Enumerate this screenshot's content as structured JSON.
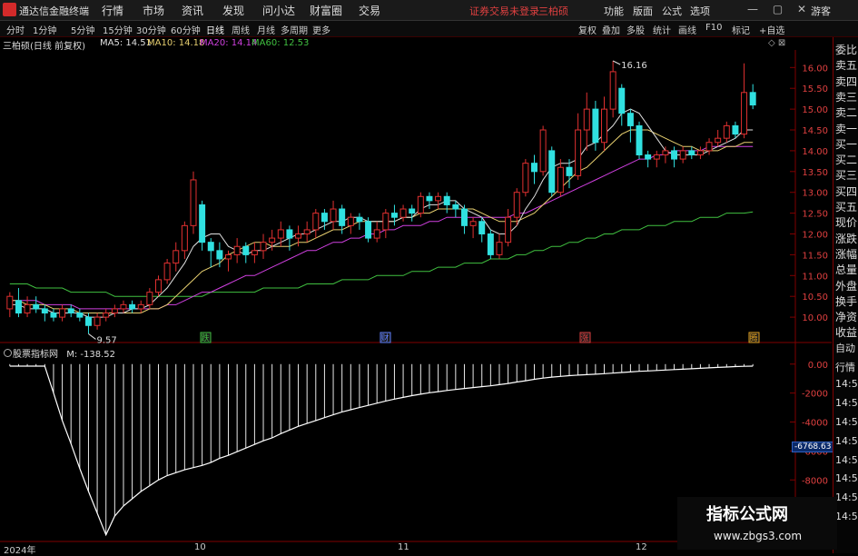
{
  "app": {
    "title": "通达信金融终端",
    "menu": [
      "行情",
      "市场",
      "资讯",
      "发现",
      "问小达",
      "财富圈",
      "交易"
    ],
    "login_status": "证券交易未登录",
    "stock_top": "三柏硕",
    "right_menu": [
      "功能",
      "版面",
      "公式",
      "选项"
    ],
    "share_label": "游客",
    "window_controls": "— ▢ ✕"
  },
  "periods": [
    "分时",
    "1分钟",
    "5分钟",
    "15分钟",
    "30分钟",
    "60分钟",
    "日线",
    "周线",
    "月线",
    "多周期",
    "更多"
  ],
  "active_period": "日线",
  "tools": [
    "复权",
    "叠加",
    "多股",
    "统计",
    "画线",
    "F10",
    "标记",
    "+自选"
  ],
  "stock": {
    "title": "三柏硕(日线 前复权)",
    "ma": [
      {
        "label": "MA5: 14.51",
        "color": "#e0e0e0"
      },
      {
        "label": "MA10: 14.18",
        "color": "#e8d070"
      },
      {
        "label": "MA20: 14.14",
        "color": "#d040e0"
      },
      {
        "label": "MA60: 12.53",
        "color": "#40c040"
      }
    ]
  },
  "price_axis": [
    "16.00",
    "15.50",
    "15.00",
    "14.50",
    "14.00",
    "13.50",
    "13.00",
    "12.50",
    "12.00",
    "11.50",
    "11.00",
    "10.50",
    "10.00"
  ],
  "annotations": {
    "high": "16.16",
    "low": "9.57",
    "events": [
      {
        "text": "跌",
        "color": "#40c040"
      },
      {
        "text": "财",
        "color": "#6080ff"
      },
      {
        "text": "涨",
        "color": "#e04040"
      },
      {
        "text": "腾",
        "color": "#e0a020"
      }
    ]
  },
  "sub_panel": {
    "title": "股票指标网",
    "value": "M: -138.52",
    "axis": [
      "0.00",
      "-2000",
      "-4000",
      "-6000",
      "-8000",
      "-10000"
    ],
    "current_value": "-6768.63"
  },
  "date_axis": [
    "2024年",
    "10",
    "11",
    "12"
  ],
  "right_panel": [
    "委比",
    "卖五",
    "卖四",
    "卖三",
    "卖二",
    "卖一",
    "买一",
    "买二",
    "买三",
    "买四",
    "买五",
    "现价",
    "涨跌",
    "涨幅",
    "总量",
    "外盘",
    "换手",
    "净资",
    "收益",
    "自动",
    "行情",
    "14:5",
    "14:5",
    "14:5",
    "14:5",
    "14:5",
    "14:5",
    "14:5",
    "14:5"
  ],
  "watermark": {
    "text": "指标公式网",
    "url": "www.zbgs3.com"
  },
  "colors": {
    "up": "#e03030",
    "down": "#30e0e0",
    "ma5": "#e0e0e0",
    "ma10": "#e8d070",
    "ma20": "#d040e0",
    "ma60": "#40c040"
  },
  "chart_data": {
    "type": "candlestick",
    "title": "三柏硕(日线 前复权)",
    "ylim": [
      9.5,
      16.4
    ],
    "candles": [
      [
        10.2,
        10.5,
        10.0,
        10.6
      ],
      [
        10.4,
        10.1,
        10.0,
        10.7
      ],
      [
        10.1,
        10.3,
        10.0,
        10.5
      ],
      [
        10.3,
        10.2,
        10.1,
        10.5
      ],
      [
        10.2,
        10.1,
        9.9,
        10.3
      ],
      [
        10.1,
        10.0,
        9.9,
        10.2
      ],
      [
        10.0,
        10.2,
        9.9,
        10.3
      ],
      [
        10.2,
        10.1,
        10.0,
        10.3
      ],
      [
        10.1,
        10.0,
        9.9,
        10.2
      ],
      [
        10.0,
        9.8,
        9.6,
        10.1
      ],
      [
        9.8,
        10.0,
        9.7,
        10.1
      ],
      [
        10.0,
        10.1,
        9.9,
        10.2
      ],
      [
        10.1,
        10.2,
        10.0,
        10.3
      ],
      [
        10.2,
        10.3,
        10.1,
        10.4
      ],
      [
        10.3,
        10.2,
        10.1,
        10.4
      ],
      [
        10.2,
        10.3,
        10.1,
        10.4
      ],
      [
        10.3,
        10.6,
        10.2,
        10.7
      ],
      [
        10.6,
        10.9,
        10.5,
        11.0
      ],
      [
        10.9,
        11.3,
        10.8,
        11.4
      ],
      [
        11.3,
        11.6,
        11.1,
        11.8
      ],
      [
        11.6,
        12.2,
        11.4,
        12.3
      ],
      [
        12.2,
        13.3,
        12.0,
        13.5
      ],
      [
        12.7,
        11.8,
        11.6,
        12.8
      ],
      [
        11.8,
        11.6,
        11.2,
        11.9
      ],
      [
        11.6,
        11.4,
        11.2,
        11.8
      ],
      [
        11.4,
        11.5,
        11.1,
        11.6
      ],
      [
        11.5,
        11.7,
        11.3,
        11.9
      ],
      [
        11.7,
        11.5,
        11.3,
        11.8
      ],
      [
        11.5,
        11.6,
        11.3,
        11.8
      ],
      [
        11.6,
        11.8,
        11.4,
        12.0
      ],
      [
        11.8,
        11.9,
        11.6,
        12.1
      ],
      [
        11.9,
        12.1,
        11.7,
        12.3
      ],
      [
        12.1,
        11.9,
        11.6,
        12.2
      ],
      [
        11.9,
        12.0,
        11.7,
        12.2
      ],
      [
        12.0,
        12.1,
        11.8,
        12.3
      ],
      [
        12.1,
        12.5,
        11.9,
        12.6
      ],
      [
        12.5,
        12.3,
        12.1,
        12.6
      ],
      [
        12.3,
        12.6,
        12.1,
        12.8
      ],
      [
        12.6,
        12.2,
        12.0,
        12.7
      ],
      [
        12.2,
        12.4,
        12.0,
        12.5
      ],
      [
        12.4,
        12.3,
        12.1,
        12.5
      ],
      [
        12.3,
        11.9,
        11.8,
        12.4
      ],
      [
        11.9,
        12.1,
        11.8,
        12.3
      ],
      [
        12.1,
        12.5,
        11.9,
        12.6
      ],
      [
        12.5,
        12.4,
        12.2,
        12.7
      ],
      [
        12.4,
        12.6,
        12.3,
        12.7
      ],
      [
        12.6,
        12.5,
        12.3,
        12.7
      ],
      [
        12.5,
        12.9,
        12.4,
        13.0
      ],
      [
        12.9,
        12.8,
        12.6,
        13.0
      ],
      [
        12.8,
        12.9,
        12.6,
        13.0
      ],
      [
        12.9,
        12.7,
        12.5,
        13.0
      ],
      [
        12.7,
        12.6,
        12.4,
        12.8
      ],
      [
        12.6,
        12.2,
        12.0,
        12.7
      ],
      [
        12.2,
        12.3,
        11.9,
        12.4
      ],
      [
        12.3,
        12.0,
        11.8,
        12.4
      ],
      [
        12.0,
        11.5,
        11.4,
        12.1
      ],
      [
        11.5,
        11.8,
        11.4,
        12.0
      ],
      [
        11.8,
        12.4,
        11.7,
        12.6
      ],
      [
        12.4,
        13.0,
        12.2,
        13.1
      ],
      [
        13.0,
        13.7,
        12.9,
        13.8
      ],
      [
        13.7,
        13.5,
        13.2,
        13.9
      ],
      [
        13.5,
        14.5,
        13.4,
        14.6
      ],
      [
        14.0,
        13.0,
        12.9,
        14.1
      ],
      [
        13.0,
        13.6,
        12.9,
        13.8
      ],
      [
        13.6,
        13.4,
        13.1,
        13.8
      ],
      [
        13.4,
        14.5,
        13.3,
        14.9
      ],
      [
        14.5,
        15.0,
        14.0,
        15.4
      ],
      [
        15.0,
        14.2,
        14.0,
        15.2
      ],
      [
        14.2,
        15.0,
        14.0,
        15.3
      ],
      [
        15.0,
        15.9,
        14.8,
        16.16
      ],
      [
        15.5,
        14.9,
        14.6,
        15.6
      ],
      [
        14.9,
        14.6,
        14.2,
        15.0
      ],
      [
        14.6,
        13.9,
        13.8,
        14.7
      ],
      [
        13.9,
        13.8,
        13.6,
        14.0
      ],
      [
        13.8,
        13.9,
        13.6,
        14.0
      ],
      [
        13.9,
        14.0,
        13.7,
        14.1
      ],
      [
        14.0,
        13.8,
        13.6,
        14.1
      ],
      [
        13.8,
        14.0,
        13.7,
        14.1
      ],
      [
        14.0,
        13.9,
        13.8,
        14.1
      ],
      [
        13.9,
        14.0,
        13.8,
        14.1
      ],
      [
        14.0,
        14.2,
        13.9,
        14.3
      ],
      [
        14.2,
        14.3,
        14.1,
        14.5
      ],
      [
        14.3,
        14.6,
        14.2,
        14.7
      ],
      [
        14.6,
        14.4,
        14.3,
        14.7
      ],
      [
        14.4,
        15.4,
        14.3,
        16.1
      ],
      [
        15.4,
        15.1,
        15.0,
        15.6
      ]
    ],
    "ma5": [
      10.3,
      10.3,
      10.2,
      10.2,
      10.2,
      10.1,
      10.1,
      10.1,
      10.1,
      10.0,
      10.0,
      10.0,
      10.1,
      10.1,
      10.2,
      10.2,
      10.3,
      10.5,
      10.7,
      11.0,
      11.3,
      11.7,
      11.9,
      12.0,
      12.0,
      11.7,
      11.6,
      11.5,
      11.6,
      11.6,
      11.7,
      11.8,
      11.9,
      12.0,
      12.0,
      12.1,
      12.2,
      12.3,
      12.3,
      12.4,
      12.4,
      12.3,
      12.3,
      12.3,
      12.3,
      12.4,
      12.4,
      12.6,
      12.7,
      12.7,
      12.8,
      12.8,
      12.6,
      12.5,
      12.4,
      12.1,
      12.0,
      12.0,
      12.2,
      12.6,
      12.9,
      13.3,
      13.6,
      13.7,
      13.7,
      13.8,
      14.1,
      14.2,
      14.4,
      14.6,
      14.9,
      15.0,
      14.9,
      14.6,
      14.3,
      14.0,
      13.9,
      13.9,
      13.9,
      13.9,
      14.0,
      14.1,
      14.2,
      14.3,
      14.5,
      14.5
    ],
    "ma10": [
      10.4,
      10.4,
      10.3,
      10.3,
      10.3,
      10.2,
      10.2,
      10.2,
      10.1,
      10.1,
      10.1,
      10.1,
      10.1,
      10.1,
      10.1,
      10.1,
      10.2,
      10.2,
      10.3,
      10.5,
      10.7,
      10.9,
      11.1,
      11.2,
      11.3,
      11.5,
      11.6,
      11.7,
      11.8,
      11.8,
      11.7,
      11.7,
      11.7,
      11.8,
      11.8,
      11.9,
      12.0,
      12.1,
      12.1,
      12.2,
      12.3,
      12.3,
      12.3,
      12.3,
      12.3,
      12.4,
      12.4,
      12.5,
      12.5,
      12.6,
      12.6,
      12.6,
      12.6,
      12.6,
      12.5,
      12.4,
      12.3,
      12.3,
      12.3,
      12.4,
      12.5,
      12.7,
      12.9,
      13.1,
      13.3,
      13.5,
      13.6,
      13.8,
      14.0,
      14.2,
      14.4,
      14.5,
      14.5,
      14.5,
      14.4,
      14.3,
      14.2,
      14.1,
      14.1,
      14.0,
      14.0,
      14.0,
      14.1,
      14.1,
      14.2,
      14.2
    ],
    "ma20": [
      10.4,
      10.4,
      10.4,
      10.4,
      10.3,
      10.3,
      10.3,
      10.3,
      10.2,
      10.2,
      10.2,
      10.2,
      10.2,
      10.2,
      10.2,
      10.2,
      10.2,
      10.2,
      10.3,
      10.3,
      10.4,
      10.5,
      10.6,
      10.6,
      10.7,
      10.8,
      10.9,
      11.0,
      11.0,
      11.1,
      11.2,
      11.3,
      11.4,
      11.5,
      11.6,
      11.6,
      11.7,
      11.8,
      11.8,
      11.9,
      11.9,
      12.0,
      12.0,
      12.1,
      12.1,
      12.2,
      12.2,
      12.2,
      12.3,
      12.3,
      12.4,
      12.4,
      12.4,
      12.4,
      12.4,
      12.4,
      12.4,
      12.4,
      12.5,
      12.5,
      12.6,
      12.7,
      12.8,
      12.9,
      13.0,
      13.1,
      13.2,
      13.3,
      13.4,
      13.5,
      13.6,
      13.7,
      13.8,
      13.8,
      13.9,
      13.9,
      14.0,
      14.0,
      14.0,
      14.0,
      14.1,
      14.1,
      14.1,
      14.1,
      14.1,
      14.1
    ],
    "ma60": [
      10.8,
      10.8,
      10.8,
      10.7,
      10.7,
      10.7,
      10.7,
      10.6,
      10.6,
      10.6,
      10.6,
      10.6,
      10.5,
      10.5,
      10.5,
      10.5,
      10.5,
      10.5,
      10.5,
      10.5,
      10.5,
      10.5,
      10.5,
      10.6,
      10.6,
      10.6,
      10.6,
      10.6,
      10.6,
      10.7,
      10.7,
      10.7,
      10.7,
      10.7,
      10.8,
      10.8,
      10.8,
      10.8,
      10.9,
      10.9,
      10.9,
      10.9,
      11.0,
      11.0,
      11.0,
      11.0,
      11.1,
      11.1,
      11.1,
      11.2,
      11.2,
      11.2,
      11.3,
      11.3,
      11.3,
      11.4,
      11.4,
      11.4,
      11.5,
      11.5,
      11.6,
      11.6,
      11.7,
      11.7,
      11.8,
      11.8,
      11.9,
      11.9,
      12.0,
      12.0,
      12.1,
      12.1,
      12.1,
      12.2,
      12.2,
      12.2,
      12.3,
      12.3,
      12.3,
      12.4,
      12.4,
      12.4,
      12.5,
      12.5,
      12.5,
      12.53
    ],
    "sub_series": [
      -138,
      -138,
      -138,
      -138,
      -138,
      -2000,
      -3900,
      -5500,
      -7200,
      -8800,
      -10300,
      -11800,
      -10500,
      -9800,
      -9300,
      -8800,
      -8400,
      -8000,
      -7700,
      -7500,
      -7300,
      -7150,
      -7000,
      -6800,
      -6500,
      -6300,
      -6050,
      -5800,
      -5550,
      -5300,
      -5100,
      -4800,
      -4550,
      -4300,
      -4100,
      -3900,
      -3700,
      -3500,
      -3300,
      -3150,
      -3000,
      -2850,
      -2700,
      -2550,
      -2420,
      -2300,
      -2180,
      -2080,
      -1980,
      -1900,
      -1820,
      -1750,
      -1680,
      -1620,
      -1560,
      -1500,
      -1420,
      -1340,
      -1240,
      -1150,
      -1050,
      -970,
      -900,
      -850,
      -800,
      -760,
      -730,
      -700,
      -660,
      -620,
      -580,
      -540,
      -500,
      -470,
      -440,
      -410,
      -380,
      -350,
      -320,
      -290,
      -260,
      -230,
      -200,
      -170,
      -150,
      -138.52
    ],
    "sub_ylim": [
      -12000,
      300
    ]
  }
}
